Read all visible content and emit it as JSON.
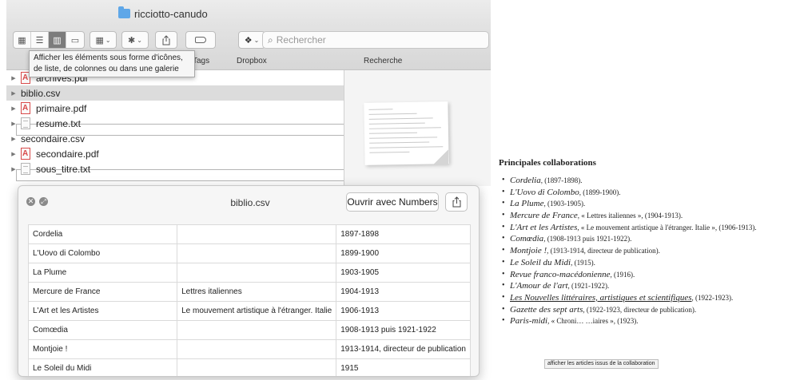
{
  "finder": {
    "folder_name": "ricciotto-canudo",
    "toolbar_labels": {
      "tags": "Tags",
      "dropbox": "Dropbox",
      "search": "Recherche"
    },
    "search_placeholder": "Rechercher",
    "tooltip": "Afficher les éléments sous forme d'icônes, de liste, de colonnes ou dans une galerie",
    "files": [
      {
        "name": "archives.pdf",
        "type": "pdf",
        "selected": false
      },
      {
        "name": "biblio.csv",
        "type": "csv",
        "selected": true
      },
      {
        "name": "primaire.pdf",
        "type": "pdf",
        "selected": false
      },
      {
        "name": "resume.txt",
        "type": "txt",
        "selected": false
      },
      {
        "name": "secondaire.csv",
        "type": "csv",
        "selected": false
      },
      {
        "name": "secondaire.pdf",
        "type": "pdf",
        "selected": false
      },
      {
        "name": "sous_titre.txt",
        "type": "txt",
        "selected": false
      }
    ]
  },
  "quicklook": {
    "title": "biblio.csv",
    "open_button": "Ouvrir avec Numbers",
    "rows": [
      [
        "Cordelia",
        "",
        "1897-1898"
      ],
      [
        "L'Uovo di Colombo",
        "",
        "1899-1900"
      ],
      [
        "La Plume",
        "",
        "1903-1905"
      ],
      [
        "Mercure de France",
        "Lettres italiennes",
        "1904-1913"
      ],
      [
        "L'Art et les Artistes",
        "Le mouvement artistique à l'étranger. Italie",
        "1906-1913"
      ],
      [
        "Comœdia",
        "",
        "1908-1913 puis 1921-1922"
      ],
      [
        "Montjoie !",
        "",
        "1913-1914, directeur de publication"
      ],
      [
        "Le Soleil du Midi",
        "",
        "1915"
      ]
    ]
  },
  "article": {
    "heading": "Principales collaborations",
    "items": [
      {
        "title": "Cordelia",
        "detail": ", (1897-1898)."
      },
      {
        "title": "L'Uovo di Colombo",
        "detail": ", (1899-1900)."
      },
      {
        "title": "La Plume",
        "detail": ", (1903-1905)."
      },
      {
        "title": "Mercure de France",
        "detail": ", « Lettres italiennes », (1904-1913)."
      },
      {
        "title": "L'Art et les Artistes",
        "detail": ", « Le mouvement artistique à l'étranger. Italie », (1906-1913)."
      },
      {
        "title": "Comœdia",
        "detail": ", (1908-1913 puis 1921-1922)."
      },
      {
        "title": "Montjoie !",
        "detail": ", (1913-1914, directeur de publication)."
      },
      {
        "title": "Le Soleil du Midi",
        "detail": ", (1915)."
      },
      {
        "title": "Revue franco-macédonienne",
        "detail": ", (1916)."
      },
      {
        "title": "L'Amour de l'art",
        "detail": ", (1921-1922)."
      },
      {
        "title": "Les Nouvelles littéraires, artistiques et scientifiques",
        "detail": ", (1922-1923)."
      },
      {
        "title": "Gazette des sept arts",
        "detail": ", (1922-1923, directeur de publication)."
      },
      {
        "title": "Paris-midi",
        "detail": ", « Chroni… …iaires », (1923)."
      }
    ],
    "link_tooltip": "afficher les articles issus de la collaboration"
  }
}
